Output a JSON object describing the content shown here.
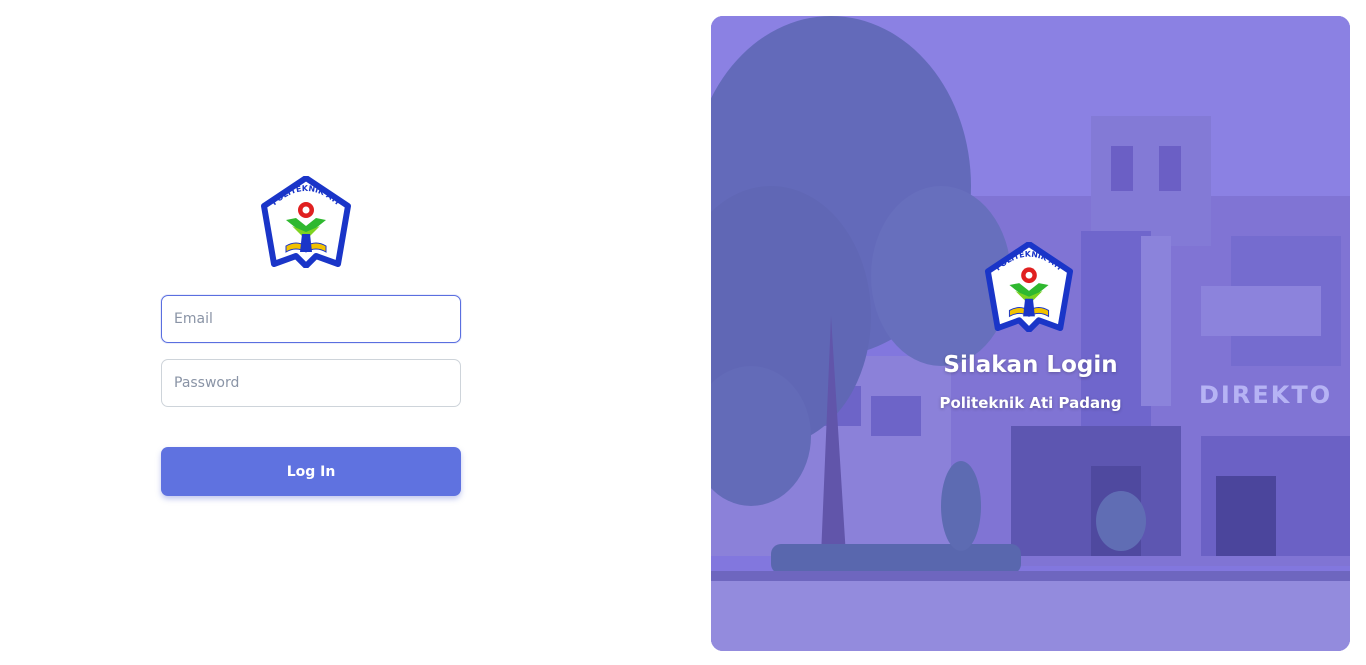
{
  "login_form": {
    "email_placeholder": "Email",
    "password_placeholder": "Password",
    "login_label": "Log In"
  },
  "hero": {
    "title": "Silakan Login",
    "subtitle": "Politeknik Ati Padang",
    "building_sign": "DIREKTO"
  },
  "logo": {
    "text": "POLITEKNIK ATI PADANG"
  },
  "colors": {
    "primary": "#5f72e0",
    "focus_border": "#5a6fe0",
    "overlay": "#7e74d6"
  }
}
